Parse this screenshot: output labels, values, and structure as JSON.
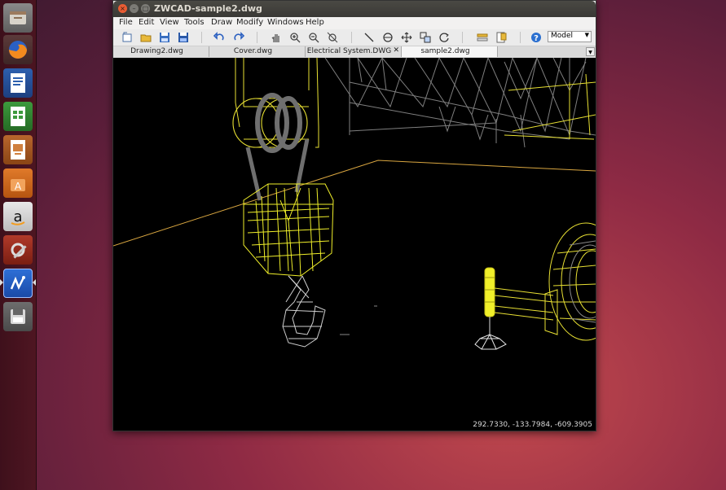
{
  "window": {
    "title": "ZWCAD-sample2.dwg",
    "controls": {
      "close": "×",
      "minimize": "–",
      "maximize": "□"
    }
  },
  "menu": [
    "File",
    "Edit",
    "View",
    "Tools",
    "Draw",
    "Modify",
    "Windows",
    "Help"
  ],
  "toolbar": {
    "buttons": [
      "new-icon",
      "open-icon",
      "save-icon",
      "saveas-icon",
      "undo-icon",
      "redo-icon",
      "pan-icon",
      "zoom-in-icon",
      "zoom-out-icon",
      "zoom-window-icon",
      "line-icon",
      "circle-icon",
      "move-icon",
      "copy-icon",
      "rotate-icon",
      "layer-icon",
      "properties-icon",
      "help-icon"
    ],
    "model_select": "Model"
  },
  "tabs": [
    {
      "label": "Drawing2.dwg",
      "active": false
    },
    {
      "label": "Cover.dwg",
      "active": false
    },
    {
      "label": "Electrical System.DWG",
      "active": false
    },
    {
      "label": "sample2.dwg",
      "active": true
    }
  ],
  "canvas": {
    "coordinates": "292.7330, -133.7984, -609.3905"
  },
  "launcher": [
    "files-icon",
    "firefox-icon",
    "writer-icon",
    "calc-icon",
    "impress-icon",
    "software-center-icon",
    "amazon-icon",
    "system-settings-icon",
    "zwcad-icon",
    "save-drive-icon"
  ],
  "colors": {
    "wire_yellow": "#ffff33",
    "wire_gray": "#8a8a8a",
    "wire_white": "#e6e6e6",
    "floor_line": "#d9a640",
    "canvas_bg": "#000000"
  }
}
